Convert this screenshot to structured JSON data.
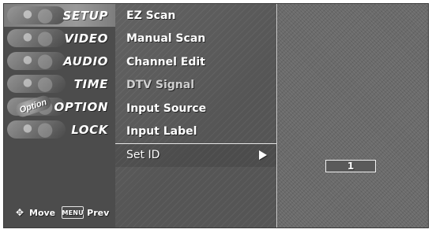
{
  "sidebar": {
    "items": [
      {
        "label": "SETUP",
        "icon": "setup-icon",
        "active": true
      },
      {
        "label": "VIDEO",
        "icon": "video-icon",
        "active": false
      },
      {
        "label": "AUDIO",
        "icon": "audio-icon",
        "active": false
      },
      {
        "label": "TIME",
        "icon": "time-icon",
        "active": false
      },
      {
        "label": "OPTION",
        "icon": "option-icon",
        "active": false,
        "badge_text": "Option"
      },
      {
        "label": "LOCK",
        "icon": "lock-icon",
        "active": false
      }
    ],
    "legend": {
      "move_label": "Move",
      "menu_key_label": "MENU",
      "prev_label": "Prev",
      "move_icon": "dpad-icon"
    }
  },
  "menu": {
    "items": [
      {
        "label": "EZ Scan",
        "state": "normal"
      },
      {
        "label": "Manual Scan",
        "state": "normal"
      },
      {
        "label": "Channel Edit",
        "state": "normal"
      },
      {
        "label": "DTV Signal",
        "state": "disabled"
      },
      {
        "label": "Input Source",
        "state": "normal"
      },
      {
        "label": "Input Label",
        "state": "normal"
      },
      {
        "label": "Set ID",
        "state": "selected",
        "has_submenu": true
      }
    ],
    "submenu_arrow_icon": "arrow-right-icon"
  },
  "set_id": {
    "value": "1"
  },
  "colors": {
    "osd_bg": "#5a5a5a",
    "sidebar_active": "#9a9a9a",
    "text": "#ffffff",
    "disabled_text": "#cfcfcf",
    "focus_line": "#e6e6e6"
  }
}
